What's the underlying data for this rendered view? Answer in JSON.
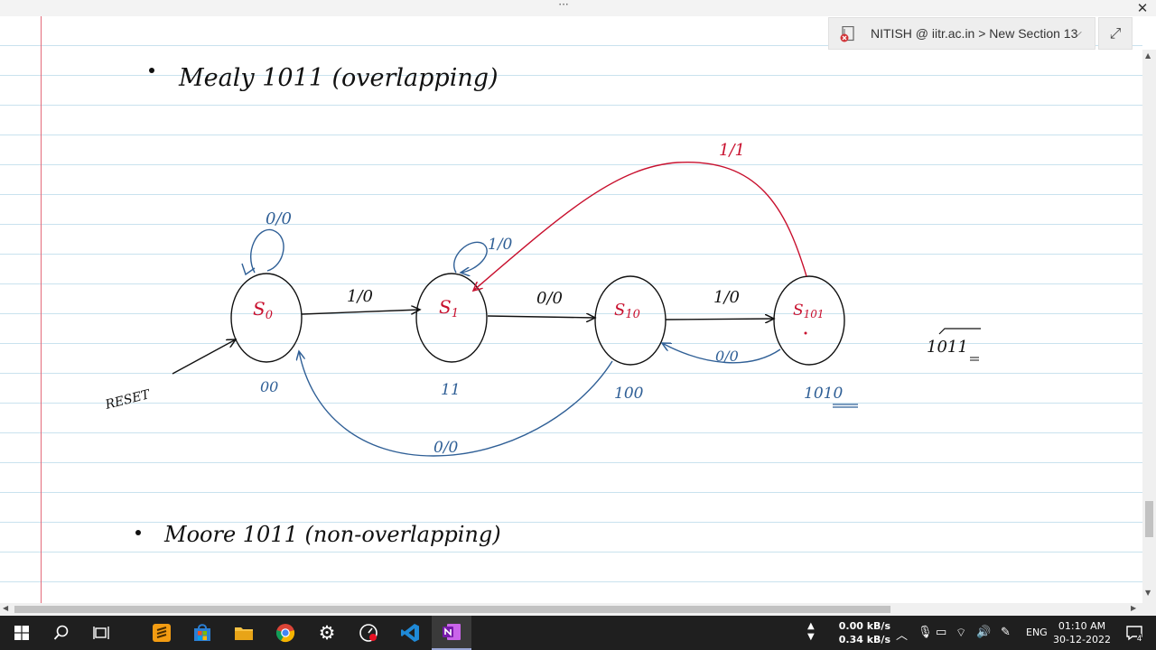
{
  "window": {
    "dots_label": "···",
    "close_label": "✕"
  },
  "breadcrumb": {
    "text": "NITISH @ iitr.ac.in > New Section 13",
    "expand_label": "⤢",
    "chevron": "⌵"
  },
  "notes": {
    "heading1": "Mealy 1011 (overlapping)",
    "heading2": "Moore 1011 (non-overlapping)",
    "states": [
      {
        "name": "S0",
        "sub": "0",
        "output_note": "00"
      },
      {
        "name": "S1",
        "sub": "1",
        "output_note": "11"
      },
      {
        "name": "S10",
        "sub": "10",
        "output_note": "100"
      },
      {
        "name": "S101",
        "sub": "101",
        "output_note": "1010"
      }
    ],
    "transitions": {
      "s0_self": "0/0",
      "s0_s1": "1/0",
      "s1_self": "1/0",
      "s1_s10": "0/0",
      "s10_s101": "1/0",
      "s101_s10": "0/0",
      "s10_s0": "0/0",
      "s101_s1": "1/1"
    },
    "reset_label": "RESET",
    "sequence_note": "1011"
  },
  "taskbar": {
    "network_up": "0.00 kB/s",
    "network_down": "0.34 kB/s",
    "language": "ENG",
    "time": "01:10 AM",
    "date": "30-12-2022",
    "notification_count": "4"
  },
  "colors": {
    "ink_black": "#111111",
    "ink_red": "#c8102e",
    "ink_blue": "#2f5f96",
    "margin_red": "#e46a7a",
    "rule_blue": "#c9e2ee"
  }
}
